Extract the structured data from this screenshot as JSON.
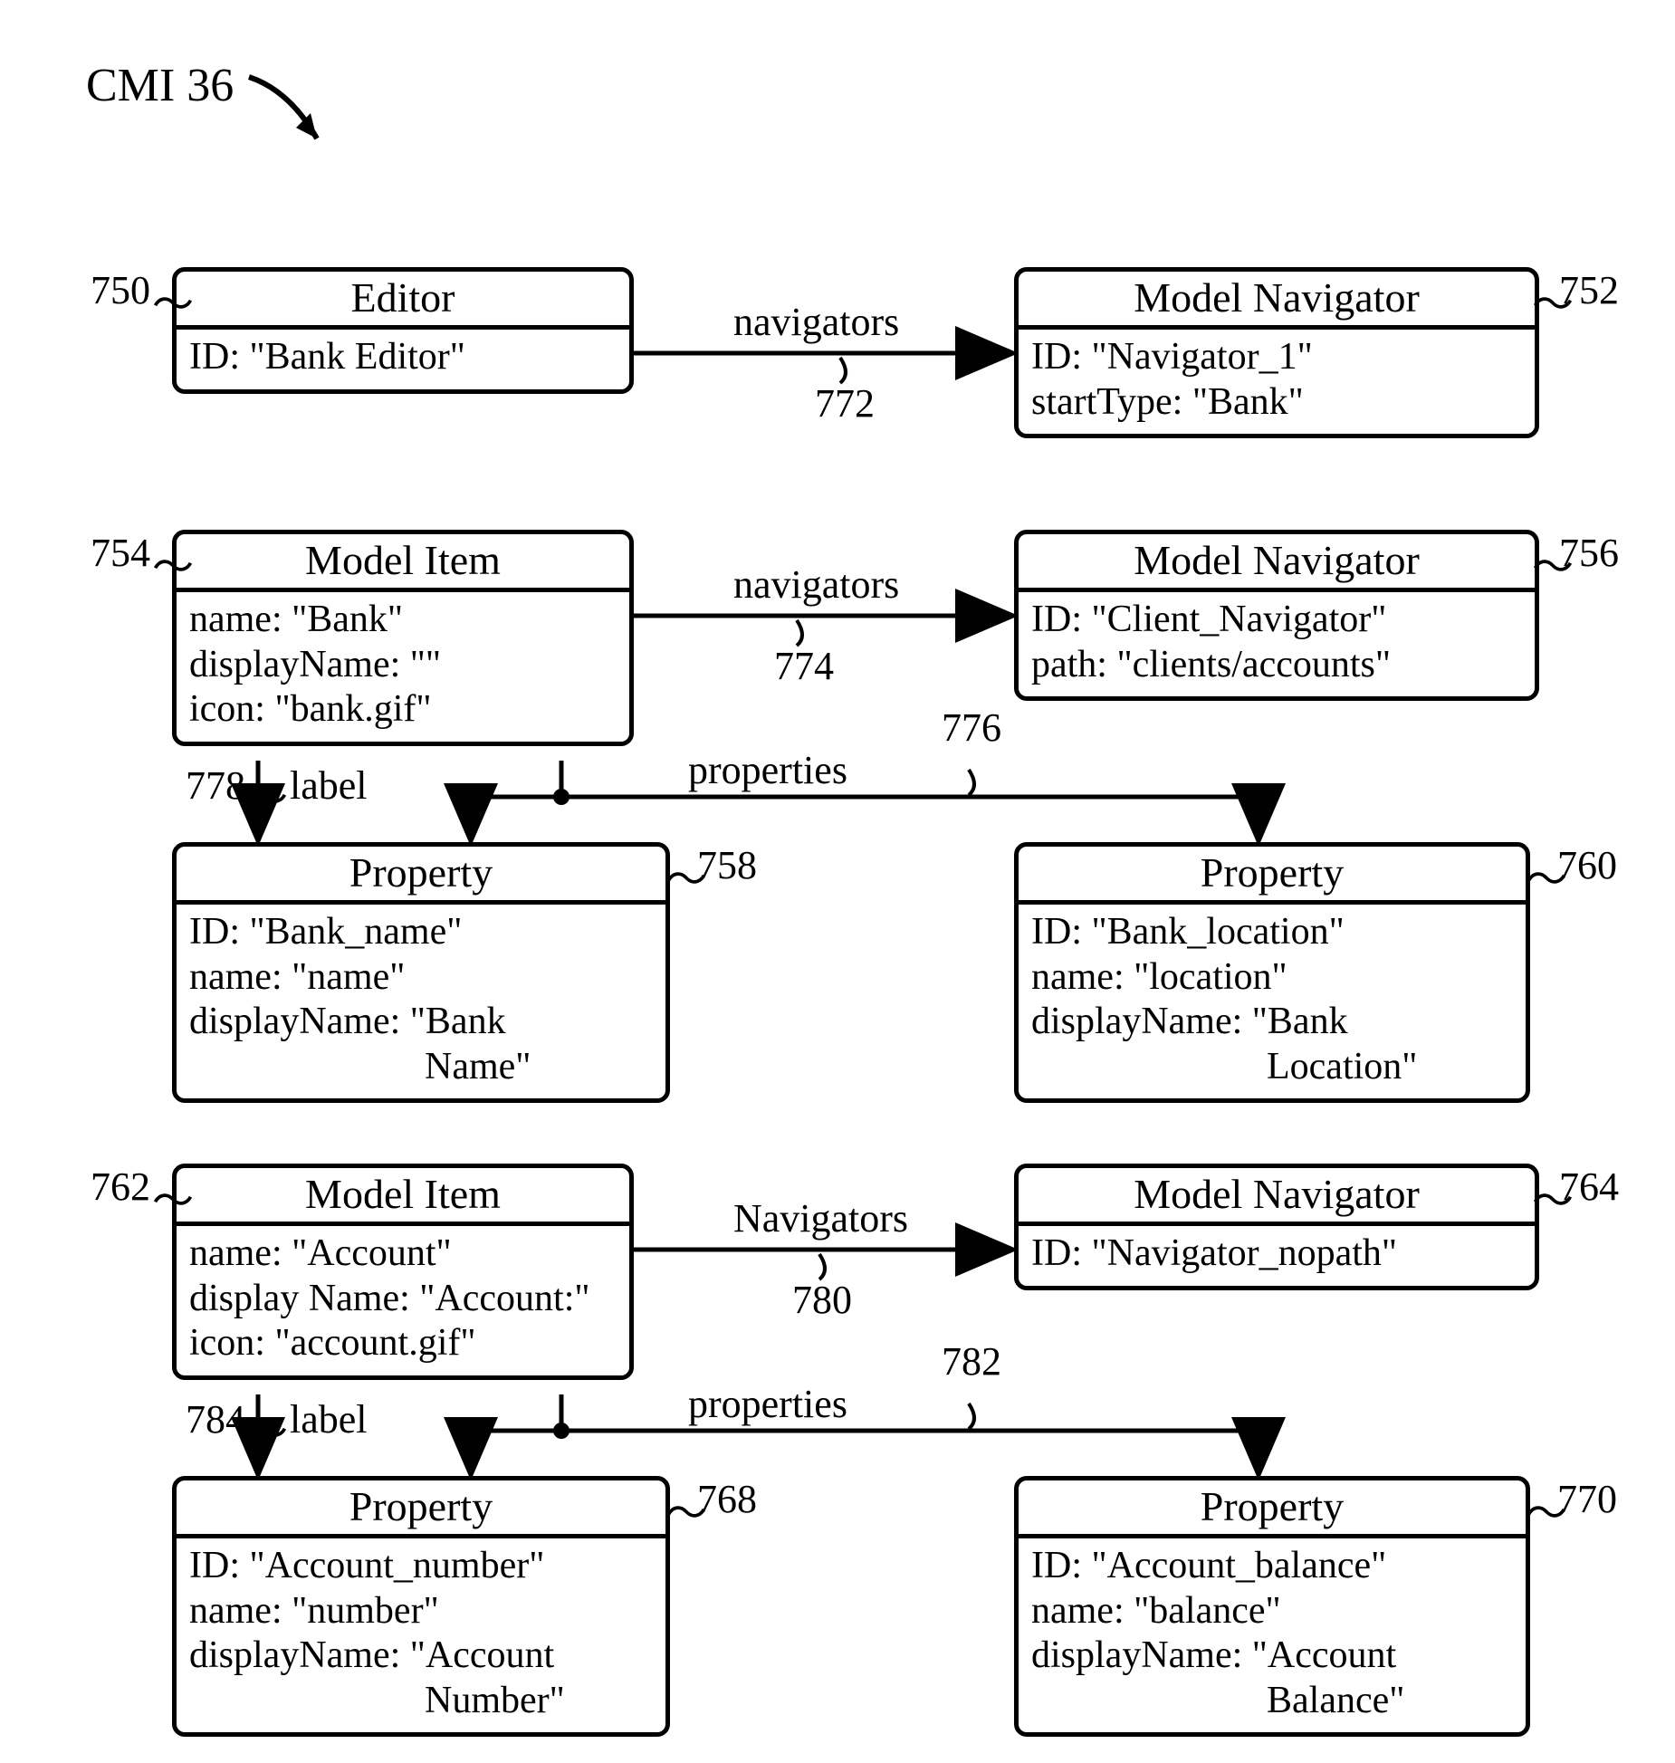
{
  "title": "CMI 36",
  "boxes": {
    "b750": {
      "header": "Editor",
      "rows": [
        "ID: \"Bank Editor\""
      ]
    },
    "b752": {
      "header": "Model Navigator",
      "rows": [
        "ID: \"Navigator_1\"",
        "startType: \"Bank\""
      ]
    },
    "b754": {
      "header": "Model Item",
      "rows": [
        "name: \"Bank\"",
        "displayName: \"\"",
        "icon: \"bank.gif\""
      ]
    },
    "b756": {
      "header": "Model Navigator",
      "rows": [
        "ID: \"Client_Navigator\"",
        "path: \"clients/accounts\""
      ]
    },
    "b758": {
      "header": "Property",
      "rows": [
        "ID: \"Bank_name\"",
        "name: \"name\"",
        "displayName: \"Bank"
      ],
      "cont": "Name\""
    },
    "b760": {
      "header": "Property",
      "rows": [
        "ID: \"Bank_location\"",
        "name: \"location\"",
        "displayName: \"Bank"
      ],
      "cont": "Location\""
    },
    "b762": {
      "header": "Model Item",
      "rows": [
        "name: \"Account\"",
        "display Name: \"Account:\"",
        "icon: \"account.gif\""
      ]
    },
    "b764": {
      "header": "Model Navigator",
      "rows": [
        "ID: \"Navigator_nopath\""
      ]
    },
    "b768": {
      "header": "Property",
      "rows": [
        "ID: \"Account_number\"",
        "name: \"number\"",
        "displayName: \"Account"
      ],
      "cont": "Number\""
    },
    "b770": {
      "header": "Property",
      "rows": [
        "ID: \"Account_balance\"",
        "name: \"balance\"",
        "displayName: \"Account"
      ],
      "cont": "Balance\""
    }
  },
  "refs": {
    "r750": "750",
    "r752": "752",
    "r754": "754",
    "r756": "756",
    "r758": "758",
    "r760": "760",
    "r762": "762",
    "r764": "764",
    "r768": "768",
    "r770": "770",
    "r772": "772",
    "r774": "774",
    "r776": "776",
    "r778": "778",
    "r780": "780",
    "r782": "782",
    "r784": "784"
  },
  "labels": {
    "l772": "navigators",
    "l774": "navigators",
    "l776": "properties",
    "l778": "label",
    "l780": "Navigators",
    "l782": "properties",
    "l784": "label"
  }
}
